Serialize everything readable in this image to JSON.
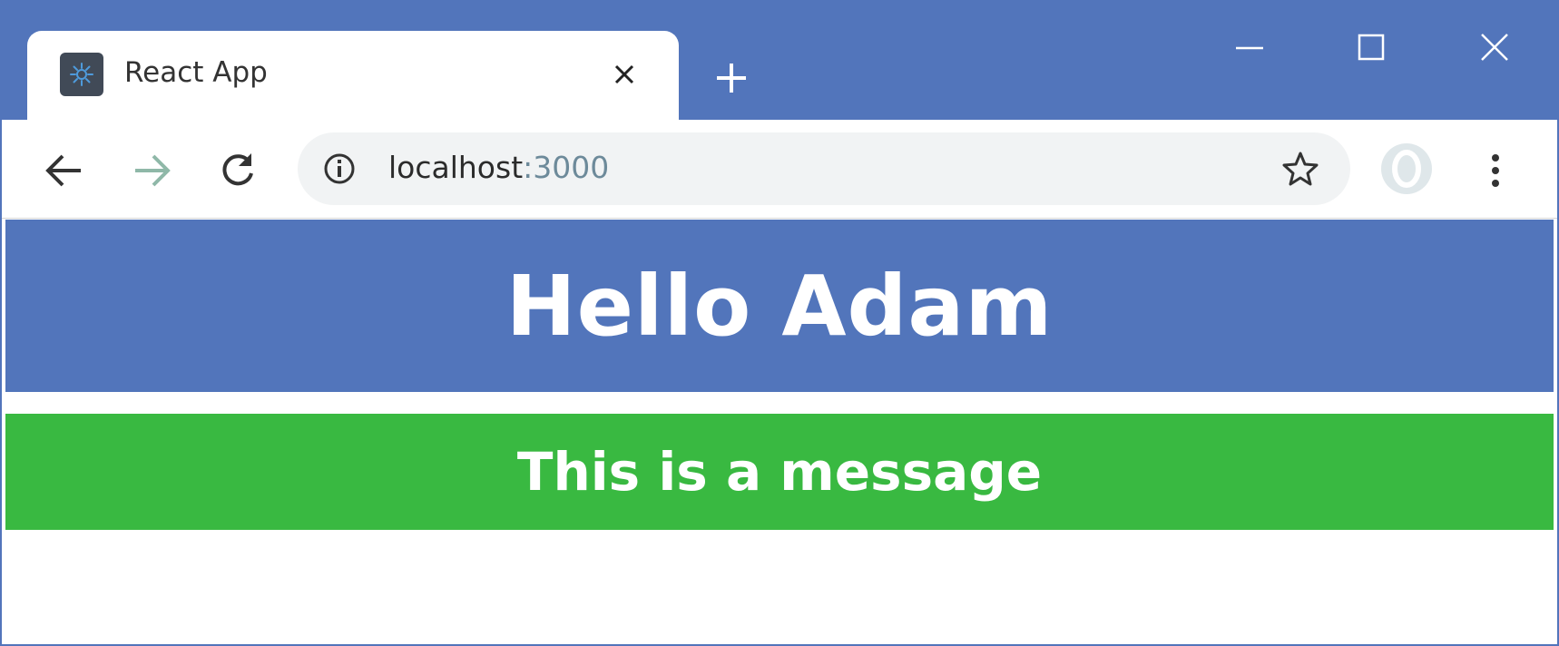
{
  "browser": {
    "tab": {
      "title": "React App",
      "favicon": "gear-icon"
    },
    "controls": {
      "minimize": "minimize-icon",
      "maximize": "maximize-icon",
      "close": "close-icon"
    },
    "toolbar": {
      "back": "back-arrow-icon",
      "forward": "forward-arrow-icon",
      "reload": "reload-icon",
      "url_host": "localhost",
      "url_port": ":3000",
      "bookmark": "star-icon",
      "profile": "avatar-icon",
      "menu": "more-vert-icon"
    },
    "colors": {
      "frame": "#5275bb",
      "omnibox": "#f1f3f4"
    }
  },
  "page": {
    "header": {
      "text": "Hello Adam",
      "background": "#5275bb"
    },
    "message": {
      "text": "This is a message",
      "background": "#39b941"
    }
  }
}
